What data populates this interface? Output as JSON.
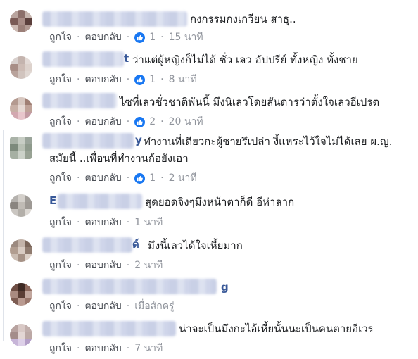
{
  "actions": {
    "like_label": "ถูกใจ",
    "reply_label": "ตอบกลับ"
  },
  "comments": [
    {
      "text": "กงกรรมกงเกวียน สาธุ..",
      "likes": "1",
      "time": "15 นาที"
    },
    {
      "name_visible": "t",
      "text": "ว่าแต่ผู้หญิงก็ไม่ได้ ชั่ว เลว อัปปรีย์ ทั้งหญิง ทั้งชาย",
      "likes": "",
      "time": "8 นาที"
    },
    {
      "text": "ไซที่เลวชั่วชาติพันนี้ มึงนิเลวโดยสันดารว่าตั้งใจเลวอีเปรต",
      "likes": "2",
      "time": "20 นาที"
    },
    {
      "name_visible": "y",
      "text": "ทำงานที่เดียวกะผู้ชายรึเปล่า งี้แหระไว้ใจไม่ได้เลย ผ.ญ.",
      "text_line2": "สมัยนี้ ..เพื่อนที่ทำงานก้อยังเอา",
      "likes": "1",
      "time": "2 นาที"
    },
    {
      "name_visible": "E",
      "text": "สุดยอดจิงๆมึงหน้าตาก็ดี อีห่าลาก",
      "likes": "",
      "time": "1 นาที"
    },
    {
      "name_visible": "ด์",
      "text": "มึงนี้เลวได้ใจเหี้ยมาก",
      "likes": "",
      "time": "2 นาที"
    },
    {
      "name_visible": "g",
      "text": "",
      "likes": "",
      "time": "เมื่อสักครู่"
    },
    {
      "text": "น่าจะเป็นมึงกะไอ้เหี้ยนั้นนะเป็นคนตายอีเวร",
      "likes": "",
      "time": "7 นาที"
    }
  ]
}
